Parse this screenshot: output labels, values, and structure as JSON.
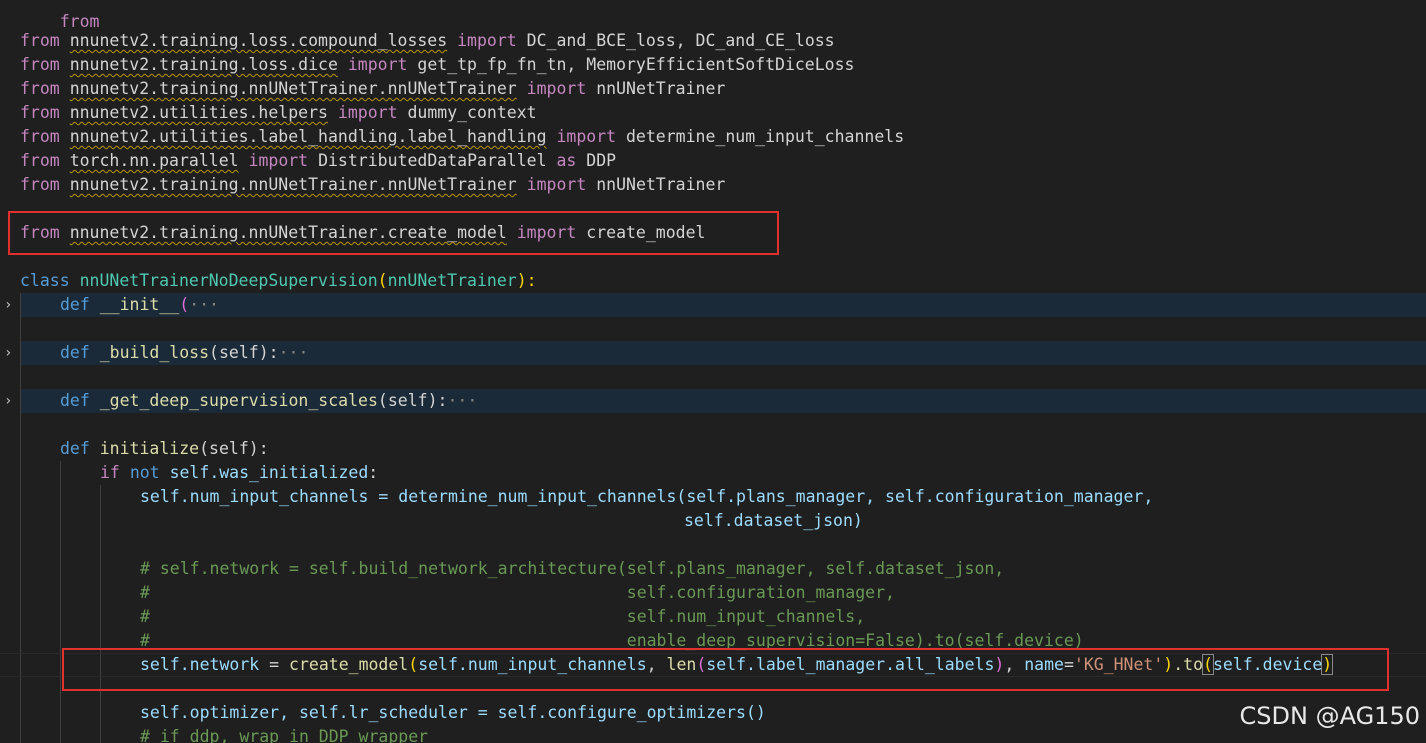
{
  "editor": {
    "top_partial": {
      "kw": "from",
      "rest": " ... "
    },
    "imports": [
      {
        "from": "from",
        "module": "nnunetv2.training.loss.compound_losses",
        "imp": "import",
        "names": "DC_and_BCE_loss, DC_and_CE_loss"
      },
      {
        "from": "from",
        "module": "nnunetv2.training.loss.dice",
        "imp": "import",
        "names": "get_tp_fp_fn_tn, MemoryEfficientSoftDiceLoss"
      },
      {
        "from": "from",
        "module": "nnunetv2.training.nnUNetTrainer.nnUNetTrainer",
        "imp": "import",
        "names": "nnUNetTrainer"
      },
      {
        "from": "from",
        "module": "nnunetv2.utilities.helpers",
        "imp": "import",
        "names": "dummy_context"
      },
      {
        "from": "from",
        "module": "nnunetv2.utilities.label_handling.label_handling",
        "imp": "import",
        "names": "determine_num_input_channels"
      },
      {
        "from": "from",
        "module": "torch.nn.parallel",
        "imp": "import",
        "names": "DistributedDataParallel",
        "as": "as",
        "alias": "DDP"
      },
      {
        "from": "from",
        "module": "nnunetv2.training.nnUNetTrainer.nnUNetTrainer",
        "imp": "import",
        "names": "nnUNetTrainer"
      }
    ],
    "highlighted_import": {
      "from": "from",
      "module": "nnunetv2.training.nnUNetTrainer.create_model",
      "imp": "import",
      "names": "create_model"
    },
    "class_line": {
      "kw": "class",
      "name": "nnUNetTrainerNoDeepSupervision",
      "base": "nnUNetTrainer",
      "open": "(",
      "close": "):"
    },
    "folded": [
      {
        "kw": "def",
        "name": "__init__",
        "sig": "(",
        "ellipsis": "···"
      },
      {
        "kw": "def",
        "name": "_build_loss",
        "sig": "(self):",
        "ellipsis": "···"
      },
      {
        "kw": "def",
        "name": "_get_deep_supervision_scales",
        "sig": "(self):",
        "ellipsis": "···"
      }
    ],
    "initialize": {
      "kw": "def",
      "name": "initialize",
      "sig": "(self):"
    },
    "if_line": {
      "if": "if",
      "not": "not",
      "self": "self",
      "attr": ".was_initialized",
      "colon": ":"
    },
    "channels_line_1": "self.num_input_channels = determine_num_input_channels(self.plans_manager, self.configuration_manager,",
    "channels_line_2": "self.dataset_json)",
    "comments": [
      "# self.network = self.build_network_architecture(self.plans_manager, self.dataset_json,",
      "#                                                self.configuration_manager,",
      "#                                                self.num_input_channels,",
      "#                                                enable_deep_supervision=False).to(self.device)"
    ],
    "network_line": {
      "lhs": "self.network",
      "eq": " = ",
      "fn": "create_model",
      "arg1": "self.num_input_channels",
      "len": "len",
      "arg2": "self.label_manager.all_labels",
      "kwname": "name",
      "kwval": "'KG_HNet'",
      "to": ".to",
      "arg3": "self.device"
    },
    "optimizer_line": "self.optimizer, self.lr_scheduler = self.configure_optimizers()",
    "ddp_comment": "# if ddp, wrap in DDP wrapper",
    "fold_chevron": "›"
  },
  "watermark": "CSDN @AG150",
  "colors": {
    "highlight_box": "#e0312f",
    "background": "#1f1f1f"
  }
}
